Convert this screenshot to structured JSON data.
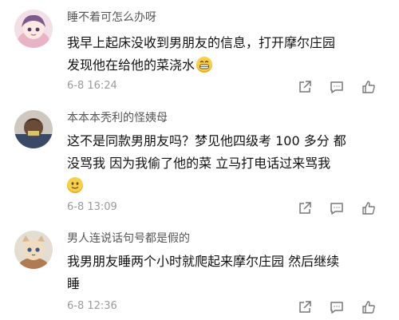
{
  "comments": [
    {
      "username": "睡不着可怎么办呀",
      "text_lines": [
        "我早上起床没收到男朋友的信息，打开摩尔庄园",
        "发现他在给他的菜浇水"
      ],
      "emoji": "grin-emoji",
      "timestamp": "6-8 16:24"
    },
    {
      "username": "本本本秃利的怪姨母",
      "text_lines": [
        "这不是同款男朋友吗？梦见他四级考 100 多分 都",
        "没骂我 因为我偷了他的菜 立马打电话过来骂我"
      ],
      "emoji": "smile-emoji",
      "timestamp": "6-8 13:09"
    },
    {
      "username": "男人连说话句号都是假的",
      "text_lines": [
        "我男朋友睡两个小时就爬起来摩尔庄园 然后继续",
        "睡"
      ],
      "emoji": "",
      "timestamp": "6-8 12:36"
    }
  ],
  "actions": [
    "share-icon",
    "comment-icon",
    "like-icon"
  ]
}
